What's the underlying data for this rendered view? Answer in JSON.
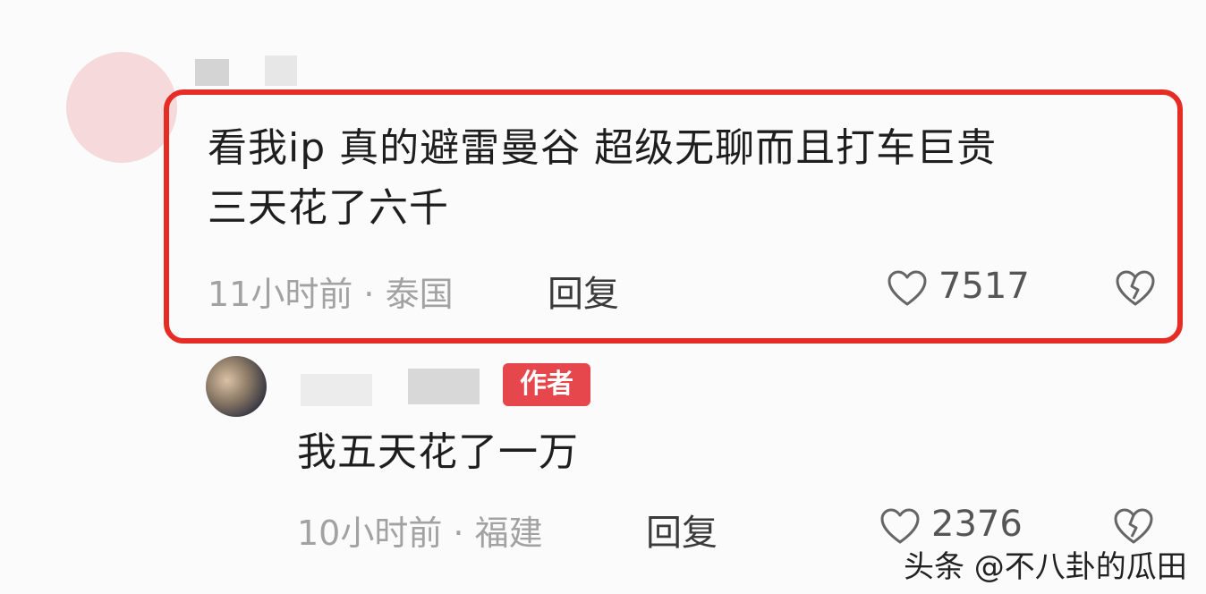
{
  "comment": {
    "text_line1": "看我ip 真的避雷曼谷 超级无聊而且打车巨贵",
    "text_line2": "三天花了六千",
    "meta": "11小时前 · 泰国",
    "reply_label": "回复",
    "likes": "7517"
  },
  "reply": {
    "badge": "作者",
    "text": "我五天花了一万",
    "meta": "10小时前 · 福建",
    "reply_label": "回复",
    "likes": "2376"
  },
  "watermark": "头条 @不八卦的瓜田",
  "colors": {
    "highlight": "#e52c25",
    "badge": "#e5474c",
    "avatar_main": "#f6d9db"
  },
  "icons": {
    "like": "heart-outline-icon",
    "dislike": "broken-heart-icon"
  }
}
